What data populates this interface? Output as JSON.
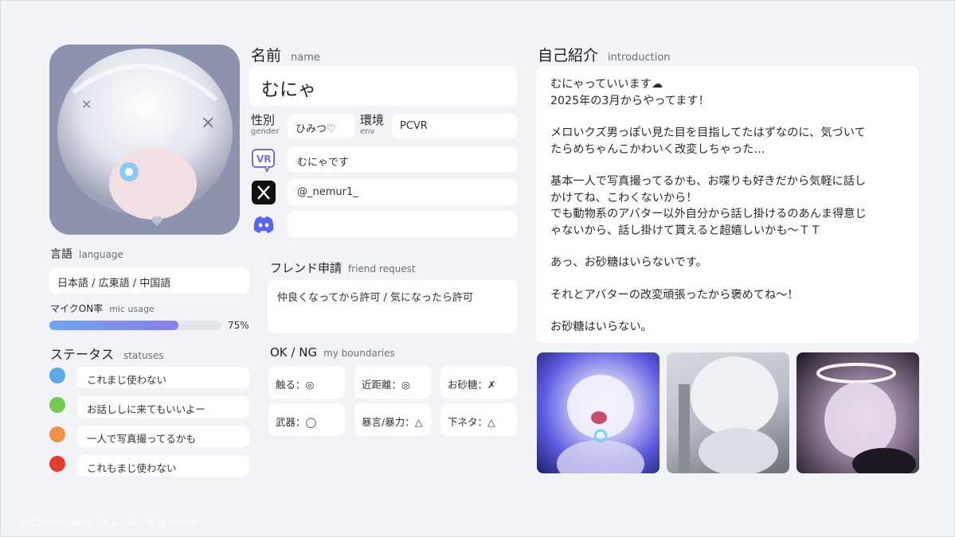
{
  "name": {
    "label": "名前",
    "sub": "name",
    "value": "むにゃ"
  },
  "gender": {
    "label": "性別",
    "sub": "gender",
    "value": "ひみつ♡"
  },
  "env": {
    "label": "環境",
    "sub": "env",
    "value": "PCVR"
  },
  "socials": {
    "vrchat": {
      "icon": "vrchat-icon",
      "value": "むにゃです"
    },
    "x": {
      "icon": "x-icon",
      "value": "@_nemur1_"
    },
    "discord": {
      "icon": "discord-icon",
      "value": ""
    }
  },
  "language": {
    "label": "言語",
    "sub": "language",
    "value": "日本語 / 広東語 / 中国語"
  },
  "mic": {
    "label": "マイクON率",
    "sub": "mic usage",
    "percent_text": "75%",
    "percent": 75
  },
  "statuses": {
    "label": "ステータス",
    "sub": "statuses",
    "items": [
      {
        "color": "#5aa9e8",
        "text": "これまじ使わない"
      },
      {
        "color": "#77c857",
        "text": "お話ししに来てもいいよー"
      },
      {
        "color": "#f0924a",
        "text": "一人で写真撮ってるかも"
      },
      {
        "color": "#e33b2e",
        "text": "これもまじ使わない"
      }
    ]
  },
  "friend_request": {
    "label": "フレンド申請",
    "sub": "friend request",
    "value": "仲良くなってから許可 / 気になったら許可"
  },
  "boundaries": {
    "label": "OK / NG",
    "sub": "my boundaries",
    "items": [
      "触る：◎",
      "近距離：◎",
      "お砂糖：✗",
      "武器：◯",
      "暴言/暴力：△",
      "下ネタ：△"
    ]
  },
  "intro": {
    "label": "自己紹介",
    "sub": "introduction",
    "lines": [
      "むにゃっていいます☁",
      "2025年の3月からやってます！",
      "",
      "メロいクズ男っぽい見た目を目指してたはずなのに、気づいて",
      "たらめちゃんこかわいく改変しちゃった…",
      "",
      "基本一人で写真撮ってるかも、お喋りも好きだから気軽に話し",
      "かけてね、こわくないから！",
      "でも動物系のアバター以外自分から話し掛けるのあんま得意じ",
      "ゃないから、話し掛けて貰えると超嬉しいかも〜ＴＴ",
      "",
      "あっ、お砂糖はいらないです。",
      "",
      "それとアバターの改変頑張ったから褒めてね〜！",
      "",
      "お砂糖はいらない。"
    ]
  },
  "footer": "VRChat自己紹介カードメーカー by @yota5d"
}
